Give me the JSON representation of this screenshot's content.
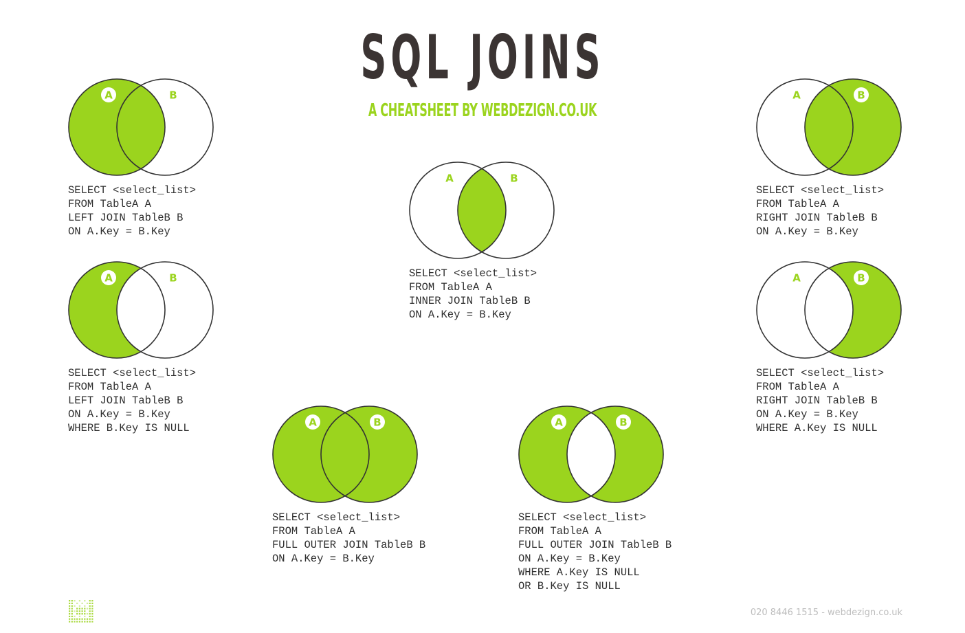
{
  "header": {
    "title": "SQL JOINS",
    "subtitle": "A CHEATSHEET BY WEBDEZIGN.CO.UK"
  },
  "colors": {
    "accent": "#9bd41e",
    "dark": "#3b3433",
    "stroke": "#333333",
    "footer": "#bdbdbd"
  },
  "labels": {
    "a": "A",
    "b": "B"
  },
  "joins": [
    {
      "name": "left-join",
      "fill": "a",
      "badged": [
        "a"
      ],
      "code": [
        "SELECT <select_list>",
        "FROM TableA A",
        "LEFT JOIN TableB B",
        "ON A.Key = B.Key"
      ]
    },
    {
      "name": "left-join-exclusive",
      "fill": "a-only",
      "badged": [
        "a"
      ],
      "code": [
        "SELECT <select_list>",
        "FROM TableA A",
        "LEFT JOIN TableB B",
        "ON A.Key = B.Key",
        "WHERE B.Key IS NULL"
      ]
    },
    {
      "name": "inner-join",
      "fill": "inner",
      "badged": [],
      "code": [
        "SELECT <select_list>",
        "FROM TableA A",
        "INNER JOIN TableB B",
        "ON A.Key = B.Key"
      ]
    },
    {
      "name": "full-outer-join",
      "fill": "all",
      "badged": [
        "a",
        "b"
      ],
      "code": [
        "SELECT <select_list>",
        "FROM TableA A",
        "FULL OUTER JOIN TableB B",
        "ON A.Key = B.Key"
      ]
    },
    {
      "name": "full-outer-join-exclusive",
      "fill": "outer",
      "badged": [
        "a",
        "b"
      ],
      "code": [
        "SELECT <select_list>",
        "FROM TableA A",
        "FULL OUTER JOIN TableB B",
        "ON A.Key = B.Key",
        "WHERE A.Key IS NULL",
        "OR B.Key IS NULL"
      ]
    },
    {
      "name": "right-join",
      "fill": "b",
      "badged": [
        "b"
      ],
      "code": [
        "SELECT <select_list>",
        "FROM TableA A",
        "RIGHT JOIN TableB B",
        "ON A.Key = B.Key"
      ]
    },
    {
      "name": "right-join-exclusive",
      "fill": "b-only",
      "badged": [
        "b"
      ],
      "code": [
        "SELECT <select_list>",
        "FROM TableA A",
        "RIGHT JOIN TableB B",
        "ON A.Key = B.Key",
        "WHERE A.Key IS NULL"
      ]
    }
  ],
  "footer": {
    "contact": "020 8446 1515 - webdezign.co.uk",
    "logo": "webdezign-logo-icon"
  }
}
